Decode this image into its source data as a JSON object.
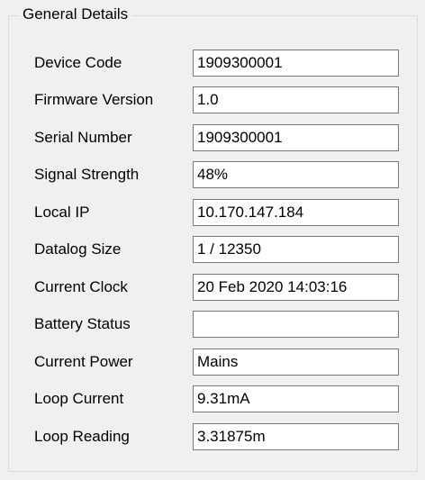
{
  "group": {
    "title": "General Details"
  },
  "fields": [
    {
      "label": "Device Code",
      "value": "1909300001"
    },
    {
      "label": "Firmware Version",
      "value": "1.0"
    },
    {
      "label": "Serial Number",
      "value": "1909300001"
    },
    {
      "label": "Signal Strength",
      "value": "48%"
    },
    {
      "label": "Local IP",
      "value": "10.170.147.184"
    },
    {
      "label": "Datalog Size",
      "value": "1 / 12350"
    },
    {
      "label": "Current Clock",
      "value": "20 Feb 2020 14:03:16"
    },
    {
      "label": "Battery Status",
      "value": ""
    },
    {
      "label": "Current Power",
      "value": "Mains"
    },
    {
      "label": "Loop Current",
      "value": "9.31mA"
    },
    {
      "label": "Loop Reading",
      "value": "3.31875m"
    }
  ]
}
